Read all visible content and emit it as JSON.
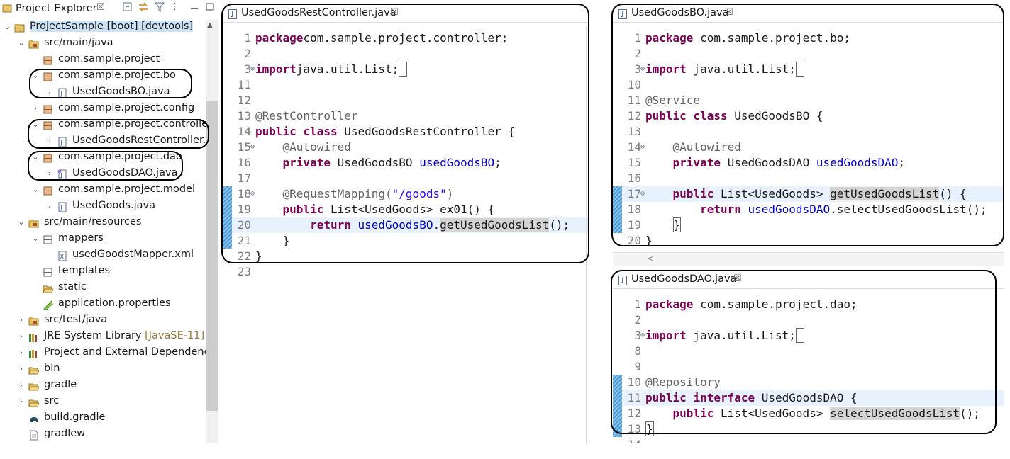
{
  "explorer": {
    "title": "Project Explorer",
    "close": "☒",
    "tree": [
      {
        "indent": 0,
        "twisty": "⌄",
        "icon": "project-icon",
        "label": "ProjectSample",
        "decoration": " [boot] [devtools]",
        "selected": true
      },
      {
        "indent": 1,
        "twisty": "⌄",
        "icon": "source-folder-icon",
        "label": "src/main/java"
      },
      {
        "indent": 2,
        "twisty": "",
        "icon": "package-icon",
        "label": "com.sample.project"
      },
      {
        "indent": 2,
        "twisty": "⌄",
        "icon": "package-icon",
        "label": "com.sample.project.bo"
      },
      {
        "indent": 3,
        "twisty": "›",
        "icon": "java-file-icon",
        "label": "UsedGoodsBO.java"
      },
      {
        "indent": 2,
        "twisty": "›",
        "icon": "package-icon",
        "label": "com.sample.project.config"
      },
      {
        "indent": 2,
        "twisty": "⌄",
        "icon": "package-icon",
        "label": "com.sample.project.controller"
      },
      {
        "indent": 3,
        "twisty": "›",
        "icon": "java-file-icon",
        "label": "UsedGoodsRestController.ja"
      },
      {
        "indent": 2,
        "twisty": "⌄",
        "icon": "package-icon",
        "label": "com.sample.project.dao"
      },
      {
        "indent": 3,
        "twisty": "›",
        "icon": "java-interface-file-icon",
        "label": "UsedGoodsDAO.java"
      },
      {
        "indent": 2,
        "twisty": "⌄",
        "icon": "package-icon",
        "label": "com.sample.project.model"
      },
      {
        "indent": 3,
        "twisty": "›",
        "icon": "java-file-icon",
        "label": "UsedGoods.java"
      },
      {
        "indent": 1,
        "twisty": "⌄",
        "icon": "source-folder-icon",
        "label": "src/main/resources"
      },
      {
        "indent": 2,
        "twisty": "⌄",
        "icon": "folder-icon",
        "label": "mappers"
      },
      {
        "indent": 3,
        "twisty": "",
        "icon": "xml-file-icon",
        "label": "usedGoodstMapper.xml"
      },
      {
        "indent": 2,
        "twisty": "",
        "icon": "folder-icon",
        "label": "templates"
      },
      {
        "indent": 2,
        "twisty": "",
        "icon": "open-folder-icon",
        "label": "static"
      },
      {
        "indent": 2,
        "twisty": "",
        "icon": "properties-file-icon",
        "label": "application.properties"
      },
      {
        "indent": 1,
        "twisty": "›",
        "icon": "source-folder-icon",
        "label": "src/test/java"
      },
      {
        "indent": 1,
        "twisty": "›",
        "icon": "library-icon",
        "label": "JRE System Library",
        "decoration": " [JavaSE-11]"
      },
      {
        "indent": 1,
        "twisty": "›",
        "icon": "library-icon",
        "label": "Project and External Dependenci"
      },
      {
        "indent": 1,
        "twisty": "›",
        "icon": "open-folder-icon",
        "label": "bin"
      },
      {
        "indent": 1,
        "twisty": "›",
        "icon": "open-folder-icon",
        "label": "gradle"
      },
      {
        "indent": 1,
        "twisty": "›",
        "icon": "open-folder-icon",
        "label": "src"
      },
      {
        "indent": 1,
        "twisty": "",
        "icon": "gradle-elephant-icon",
        "label": "build.gradle"
      },
      {
        "indent": 1,
        "twisty": "",
        "icon": "file-icon",
        "label": "gradlew"
      }
    ]
  },
  "editors": {
    "controller": {
      "file": "UsedGoodsRestController.java",
      "close": "☒",
      "lines": [
        {
          "n": "1",
          "segs": [
            [
              "kw",
              "package"
            ],
            [
              "",
              "com.sample.project.controller;"
            ]
          ]
        },
        {
          "n": "2",
          "segs": []
        },
        {
          "n": "3",
          "fold": "⊕",
          "segs": [
            [
              "kw",
              "import"
            ],
            [
              "",
              "java.util.List;"
            ],
            [
              "box",
              " "
            ]
          ]
        },
        {
          "n": "11",
          "segs": []
        },
        {
          "n": "12",
          "segs": []
        },
        {
          "n": "13",
          "segs": [
            [
              "an",
              "@RestController"
            ]
          ]
        },
        {
          "n": "14",
          "segs": [
            [
              "kw",
              "public"
            ],
            [
              "",
              " "
            ],
            [
              "kw",
              "class"
            ],
            [
              "",
              " UsedGoodsRestController {"
            ]
          ]
        },
        {
          "n": "15",
          "fold": "⊖",
          "segs": [
            [
              "",
              "    "
            ],
            [
              "an",
              "@Autowired"
            ]
          ]
        },
        {
          "n": "16",
          "segs": [
            [
              "",
              "    "
            ],
            [
              "kw",
              "private"
            ],
            [
              "",
              " UsedGoodsBO "
            ],
            [
              "fld",
              "usedGoodsBO"
            ],
            [
              "",
              ";"
            ]
          ]
        },
        {
          "n": "17",
          "segs": []
        },
        {
          "n": "18",
          "fold": "⊖",
          "bar": true,
          "segs": [
            [
              "",
              "    "
            ],
            [
              "an",
              "@RequestMapping("
            ],
            [
              "str",
              "\"/goods\""
            ],
            [
              "an",
              ")"
            ]
          ]
        },
        {
          "n": "19",
          "bar": true,
          "segs": [
            [
              "",
              "    "
            ],
            [
              "kw",
              "public"
            ],
            [
              "",
              " List<UsedGoods> ex01() {"
            ]
          ]
        },
        {
          "n": "20",
          "bar": true,
          "cur": true,
          "segs": [
            [
              "",
              "        "
            ],
            [
              "kw",
              "return"
            ],
            [
              "",
              " "
            ],
            [
              "fld",
              "usedGoodsBO"
            ],
            [
              "",
              "."
            ],
            [
              "mhl",
              "getUsedGoodsList"
            ],
            [
              "",
              "();"
            ]
          ]
        },
        {
          "n": "21",
          "bar": true,
          "segs": [
            [
              "",
              "    }"
            ]
          ]
        },
        {
          "n": "22",
          "segs": [
            [
              "",
              "}"
            ]
          ]
        },
        {
          "n": "23",
          "segs": []
        }
      ]
    },
    "bo": {
      "file": "UsedGoodsBO.java",
      "close": "☒",
      "lines": [
        {
          "n": "1",
          "segs": [
            [
              "kw",
              "package"
            ],
            [
              "",
              " com.sample.project.bo;"
            ]
          ]
        },
        {
          "n": "2",
          "segs": []
        },
        {
          "n": "3",
          "fold": "⊕",
          "segs": [
            [
              "kw",
              "import"
            ],
            [
              "",
              " java.util.List;"
            ],
            [
              "box",
              " "
            ]
          ]
        },
        {
          "n": "10",
          "segs": []
        },
        {
          "n": "11",
          "segs": [
            [
              "an",
              "@Service"
            ]
          ]
        },
        {
          "n": "12",
          "segs": [
            [
              "kw",
              "public"
            ],
            [
              "",
              " "
            ],
            [
              "kw",
              "class"
            ],
            [
              "",
              " UsedGoodsBO {"
            ]
          ]
        },
        {
          "n": "13",
          "segs": []
        },
        {
          "n": "14",
          "fold": "⊖",
          "segs": [
            [
              "",
              "    "
            ],
            [
              "an",
              "@Autowired"
            ]
          ]
        },
        {
          "n": "15",
          "segs": [
            [
              "",
              "    "
            ],
            [
              "kw",
              "private"
            ],
            [
              "",
              " UsedGoodsDAO "
            ],
            [
              "fld",
              "usedGoodsDAO"
            ],
            [
              "",
              ";"
            ]
          ]
        },
        {
          "n": "16",
          "segs": []
        },
        {
          "n": "17",
          "fold": "⊖",
          "bar": true,
          "cur": true,
          "segs": [
            [
              "",
              "    "
            ],
            [
              "kw",
              "public"
            ],
            [
              "",
              " List<UsedGoods> "
            ],
            [
              "mhl",
              "getUsedGoodsList"
            ],
            [
              "",
              "() {"
            ]
          ]
        },
        {
          "n": "18",
          "bar": true,
          "segs": [
            [
              "",
              "        "
            ],
            [
              "kw",
              "return"
            ],
            [
              "",
              " "
            ],
            [
              "fld",
              "usedGoodsDAO"
            ],
            [
              "",
              ".selectUsedGoodsList();"
            ]
          ]
        },
        {
          "n": "19",
          "bar": true,
          "segs": [
            [
              "",
              "    "
            ],
            [
              "box",
              "}"
            ]
          ]
        },
        {
          "n": "20",
          "segs": [
            [
              "",
              "}"
            ]
          ]
        }
      ]
    },
    "dao": {
      "file": "UsedGoodsDAO.java",
      "close": "☒",
      "lines": [
        {
          "n": "1",
          "segs": [
            [
              "kw",
              "package"
            ],
            [
              "",
              " com.sample.project.dao;"
            ]
          ]
        },
        {
          "n": "2",
          "segs": []
        },
        {
          "n": "3",
          "fold": "⊕",
          "segs": [
            [
              "kw",
              "import"
            ],
            [
              "",
              " java.util.List;"
            ],
            [
              "box",
              " "
            ]
          ]
        },
        {
          "n": "8",
          "segs": []
        },
        {
          "n": "9",
          "segs": []
        },
        {
          "n": "10",
          "bar": true,
          "segs": [
            [
              "an",
              "@Repository"
            ]
          ]
        },
        {
          "n": "11",
          "bar": true,
          "cur": true,
          "segs": [
            [
              "kw",
              "public"
            ],
            [
              "",
              " "
            ],
            [
              "kw",
              "interface"
            ],
            [
              "",
              " UsedGoodsDAO {"
            ]
          ]
        },
        {
          "n": "12",
          "bar": true,
          "segs": [
            [
              "",
              "    "
            ],
            [
              "kw",
              "public"
            ],
            [
              "",
              " List<UsedGoods> "
            ],
            [
              "mhl",
              "selectUsedGoodsList"
            ],
            [
              "",
              "();"
            ]
          ]
        },
        {
          "n": "13",
          "bar": true,
          "segs": [
            [
              "box",
              "}"
            ]
          ]
        },
        {
          "n": "14",
          "segs": []
        }
      ]
    }
  },
  "colors": {
    "keyword": "#7f0055",
    "annotation": "#646464",
    "field": "#0000c0",
    "string": "#2a00ff",
    "selection": "#cde3f5",
    "current_line": "#e8f2fe"
  }
}
